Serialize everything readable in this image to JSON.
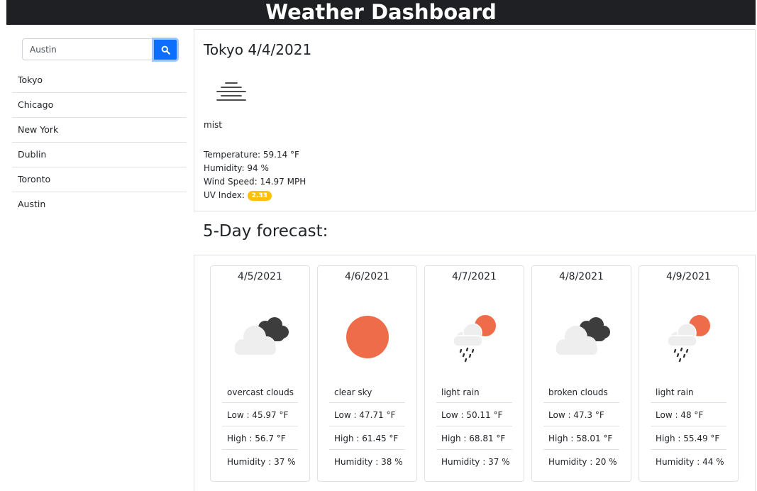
{
  "header": {
    "title": "Weather Dashboard"
  },
  "search": {
    "value": "Austin",
    "placeholder": "Austin"
  },
  "history": [
    "Tokyo",
    "Chicago",
    "New York",
    "Dublin",
    "Toronto",
    "Austin"
  ],
  "current": {
    "title": "Tokyo 4/4/2021",
    "icon": "mist-icon",
    "description": "mist",
    "temperature": "Temperature: 59.14 °F",
    "humidity": "Humidity: 94 %",
    "wind": "Wind Speed: 14.97 MPH",
    "uv_label": "UV Index:",
    "uv_value": "2.33",
    "uv_color": "#ffc107"
  },
  "forecast": {
    "heading": "5-Day forecast:",
    "days": [
      {
        "date": "4/5/2021",
        "icon": "overcast-clouds-icon",
        "description": "overcast clouds",
        "low": "Low : 45.97 °F",
        "high": "High : 56.7 °F",
        "humidity": "Humidity : 37 %"
      },
      {
        "date": "4/6/2021",
        "icon": "clear-sky-icon",
        "description": "clear sky",
        "low": "Low : 47.71 °F",
        "high": "High : 61.45 °F",
        "humidity": "Humidity : 38 %"
      },
      {
        "date": "4/7/2021",
        "icon": "light-rain-icon",
        "description": "light rain",
        "low": "Low : 50.11 °F",
        "high": "High : 68.81 °F",
        "humidity": "Humidity : 37 %"
      },
      {
        "date": "4/8/2021",
        "icon": "broken-clouds-icon",
        "description": "broken clouds",
        "low": "Low : 47.3 °F",
        "high": "High : 58.01 °F",
        "humidity": "Humidity : 20 %"
      },
      {
        "date": "4/9/2021",
        "icon": "light-rain-icon",
        "description": "light rain",
        "low": "Low : 48 °F",
        "high": "High : 55.49 °F",
        "humidity": "Humidity : 44 %"
      }
    ]
  },
  "colors": {
    "header_bg": "#1f2023",
    "search_button": "#0d6efd",
    "sun": "#ef6c4a",
    "dark_cloud": "#3d3d3d",
    "light_cloud": "#eeeeee"
  }
}
